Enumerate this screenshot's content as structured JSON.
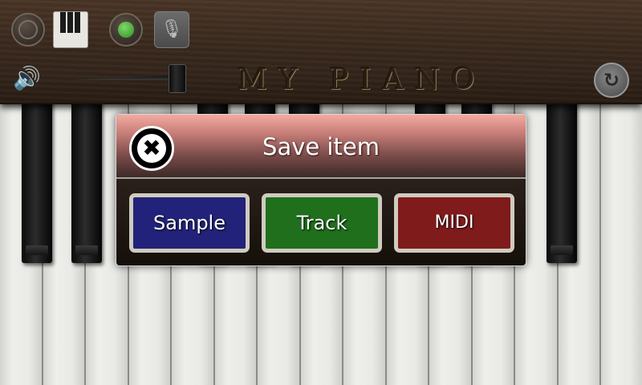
{
  "app": {
    "title": "MY PIANO",
    "colors": {
      "wood": "#3b2a1e",
      "record_indicator": "#4fbf3a",
      "sample_button": "#22227a",
      "track_button": "#1f6f1c",
      "midi_button": "#7f1b1b",
      "dialog_header": "#e8a49a"
    }
  },
  "toolbar": {
    "icons": {
      "metronome": "metronome-icon",
      "keys": "piano-keys-icon",
      "record": "record-icon",
      "microphone": "microphone-icon",
      "volume": "volume-icon",
      "reset": "reset-icon"
    },
    "volume_glyph": "🔊",
    "mic_glyph": "🎙",
    "reset_glyph": "↻",
    "volume_level": 1.0
  },
  "dialog": {
    "title": "Save item",
    "close_glyph": "✖",
    "buttons": {
      "sample": "Sample",
      "track": "Track",
      "midi": "MIDI"
    }
  }
}
